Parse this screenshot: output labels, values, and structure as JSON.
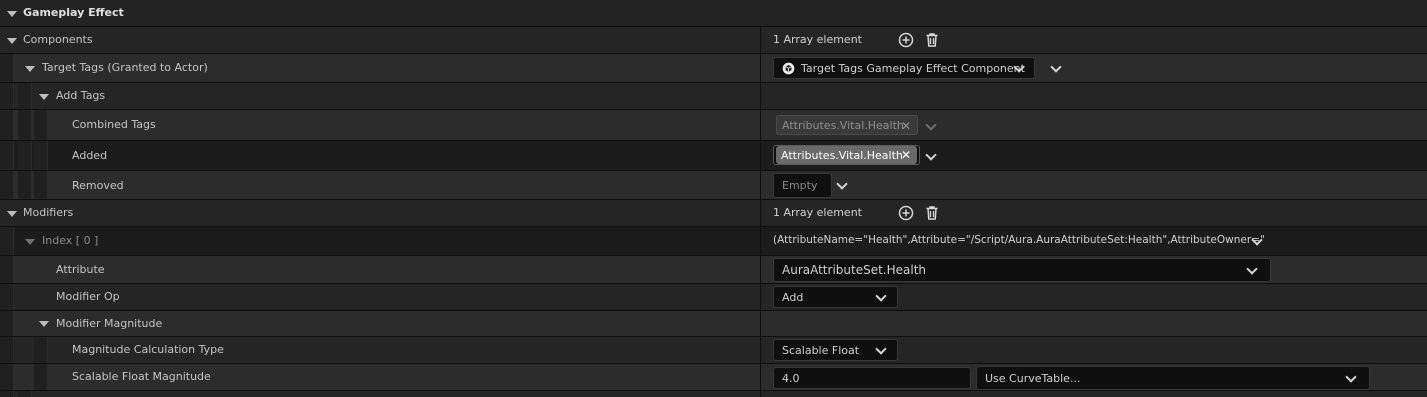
{
  "section": {
    "title": "Gameplay Effect"
  },
  "components": {
    "label": "Components",
    "array_count": "1 Array element",
    "target_tags": {
      "label": "Target Tags (Granted to Actor)",
      "component_value": "Target Tags Gameplay Effect Component",
      "add_tags": {
        "label": "Add Tags",
        "combined": {
          "label": "Combined Tags",
          "tag": "Attributes.Vital.Health"
        },
        "added": {
          "label": "Added",
          "tag": "Attributes.Vital.Health"
        },
        "removed": {
          "label": "Removed",
          "value": "Empty"
        }
      }
    }
  },
  "modifiers": {
    "label": "Modifiers",
    "array_count": "1 Array element",
    "index": {
      "label": "Index [ 0 ]",
      "summary": "(AttributeName=\"Health\",Attribute=\"/Script/Aura.AuraAttributeSet:Health\",AttributeOwner=\""
    },
    "attribute": {
      "label": "Attribute",
      "value": "AuraAttributeSet.Health"
    },
    "modifier_op": {
      "label": "Modifier Op",
      "value": "Add"
    },
    "magnitude": {
      "label": "Modifier Magnitude",
      "calc_type": {
        "label": "Magnitude Calculation Type",
        "value": "Scalable Float"
      },
      "scalable": {
        "label": "Scalable Float Magnitude",
        "value": "4.0",
        "curve": "Use CurveTable..."
      }
    }
  },
  "icons": {
    "add": "plus-circle-icon",
    "delete": "trash-icon",
    "component": "cube-icon"
  }
}
